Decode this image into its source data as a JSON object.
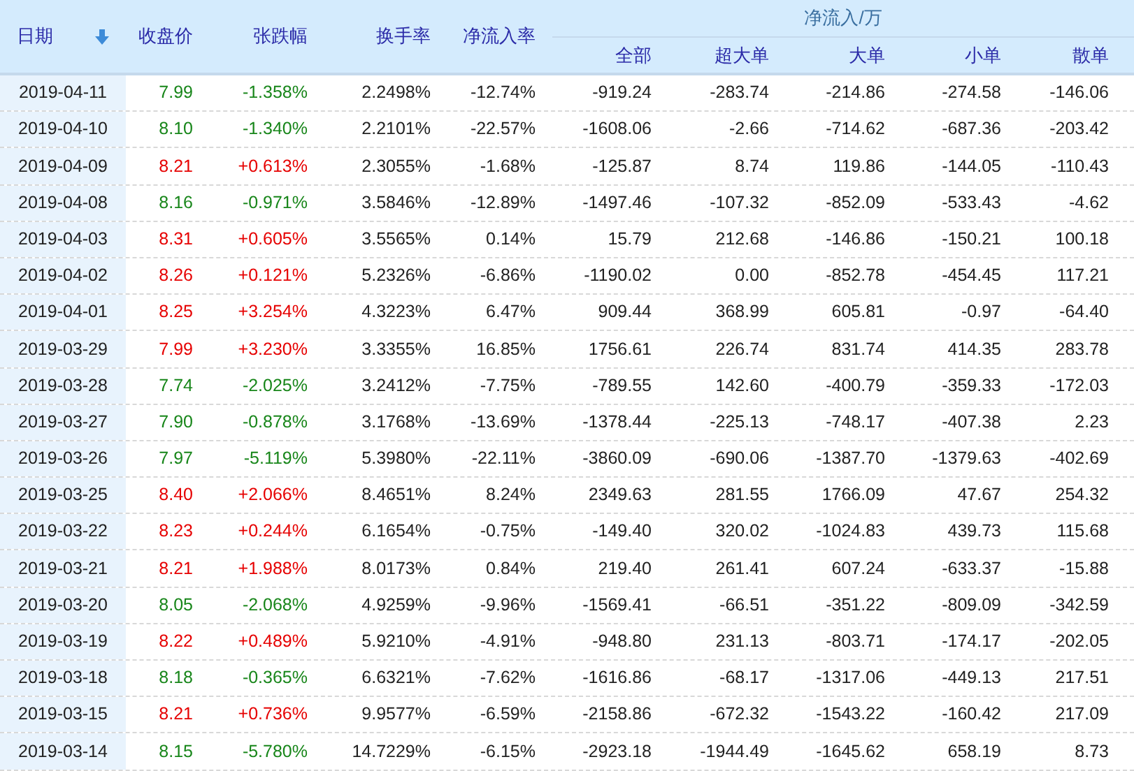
{
  "header": {
    "group_title": "净流入/万",
    "columns": [
      {
        "label": "日期",
        "sorted": true
      },
      {
        "label": "收盘价",
        "sorted": false
      },
      {
        "label": "张跌幅",
        "sorted": false
      },
      {
        "label": "换手率",
        "sorted": false
      },
      {
        "label": "净流入率",
        "sorted": false
      }
    ],
    "group_columns": [
      "全部",
      "超大单",
      "大单",
      "小单",
      "散单"
    ]
  },
  "rows": [
    {
      "kind": "down",
      "cells": [
        "2019-04-11",
        "7.99",
        "-1.358%",
        "2.2498%",
        "-12.74%",
        "-919.24",
        "-283.74",
        "-214.86",
        "-274.58",
        "-146.06"
      ]
    },
    {
      "kind": "down",
      "cells": [
        "2019-04-10",
        "8.10",
        "-1.340%",
        "2.2101%",
        "-22.57%",
        "-1608.06",
        "-2.66",
        "-714.62",
        "-687.36",
        "-203.42"
      ]
    },
    {
      "kind": "up",
      "cells": [
        "2019-04-09",
        "8.21",
        "+0.613%",
        "2.3055%",
        "-1.68%",
        "-125.87",
        "8.74",
        "119.86",
        "-144.05",
        "-110.43"
      ]
    },
    {
      "kind": "down",
      "cells": [
        "2019-04-08",
        "8.16",
        "-0.971%",
        "3.5846%",
        "-12.89%",
        "-1497.46",
        "-107.32",
        "-852.09",
        "-533.43",
        "-4.62"
      ]
    },
    {
      "kind": "up",
      "cells": [
        "2019-04-03",
        "8.31",
        "+0.605%",
        "3.5565%",
        "0.14%",
        "15.79",
        "212.68",
        "-146.86",
        "-150.21",
        "100.18"
      ]
    },
    {
      "kind": "up",
      "cells": [
        "2019-04-02",
        "8.26",
        "+0.121%",
        "5.2326%",
        "-6.86%",
        "-1190.02",
        "0.00",
        "-852.78",
        "-454.45",
        "117.21"
      ]
    },
    {
      "kind": "up",
      "cells": [
        "2019-04-01",
        "8.25",
        "+3.254%",
        "4.3223%",
        "6.47%",
        "909.44",
        "368.99",
        "605.81",
        "-0.97",
        "-64.40"
      ]
    },
    {
      "kind": "up",
      "cells": [
        "2019-03-29",
        "7.99",
        "+3.230%",
        "3.3355%",
        "16.85%",
        "1756.61",
        "226.74",
        "831.74",
        "414.35",
        "283.78"
      ]
    },
    {
      "kind": "down",
      "cells": [
        "2019-03-28",
        "7.74",
        "-2.025%",
        "3.2412%",
        "-7.75%",
        "-789.55",
        "142.60",
        "-400.79",
        "-359.33",
        "-172.03"
      ]
    },
    {
      "kind": "down",
      "cells": [
        "2019-03-27",
        "7.90",
        "-0.878%",
        "3.1768%",
        "-13.69%",
        "-1378.44",
        "-225.13",
        "-748.17",
        "-407.38",
        "2.23"
      ]
    },
    {
      "kind": "down",
      "cells": [
        "2019-03-26",
        "7.97",
        "-5.119%",
        "5.3980%",
        "-22.11%",
        "-3860.09",
        "-690.06",
        "-1387.70",
        "-1379.63",
        "-402.69"
      ]
    },
    {
      "kind": "up",
      "cells": [
        "2019-03-25",
        "8.40",
        "+2.066%",
        "8.4651%",
        "8.24%",
        "2349.63",
        "281.55",
        "1766.09",
        "47.67",
        "254.32"
      ]
    },
    {
      "kind": "up",
      "cells": [
        "2019-03-22",
        "8.23",
        "+0.244%",
        "6.1654%",
        "-0.75%",
        "-149.40",
        "320.02",
        "-1024.83",
        "439.73",
        "115.68"
      ]
    },
    {
      "kind": "up",
      "cells": [
        "2019-03-21",
        "8.21",
        "+1.988%",
        "8.0173%",
        "0.84%",
        "219.40",
        "261.41",
        "607.24",
        "-633.37",
        "-15.88"
      ]
    },
    {
      "kind": "down",
      "cells": [
        "2019-03-20",
        "8.05",
        "-2.068%",
        "4.9259%",
        "-9.96%",
        "-1569.41",
        "-66.51",
        "-351.22",
        "-809.09",
        "-342.59"
      ]
    },
    {
      "kind": "up",
      "cells": [
        "2019-03-19",
        "8.22",
        "+0.489%",
        "5.9210%",
        "-4.91%",
        "-948.80",
        "231.13",
        "-803.71",
        "-174.17",
        "-202.05"
      ]
    },
    {
      "kind": "down",
      "cells": [
        "2019-03-18",
        "8.18",
        "-0.365%",
        "6.6321%",
        "-7.62%",
        "-1616.86",
        "-68.17",
        "-1317.06",
        "-449.13",
        "217.51"
      ]
    },
    {
      "kind": "up",
      "cells": [
        "2019-03-15",
        "8.21",
        "+0.736%",
        "9.9577%",
        "-6.59%",
        "-2158.86",
        "-672.32",
        "-1543.22",
        "-160.42",
        "217.09"
      ]
    },
    {
      "kind": "down",
      "cells": [
        "2019-03-14",
        "8.15",
        "-5.780%",
        "14.7229%",
        "-6.15%",
        "-2923.18",
        "-1944.49",
        "-1645.62",
        "658.19",
        "8.73"
      ]
    }
  ]
}
